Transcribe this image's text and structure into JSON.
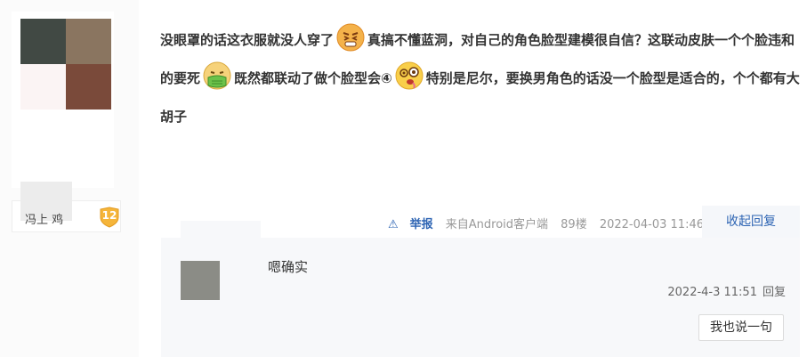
{
  "author": {
    "username": "冯上 鸡",
    "level": "12"
  },
  "post": {
    "segments": [
      "没眼罩的话这衣服就没人穿了",
      "真搞不懂蓝洞，对自己的角色脸型建模很自信？这联动皮肤一个个脸违和的要死",
      "既然都联动了做个脸型会④",
      "特别是尼尔，要换男角色的话没一个脸型是适合的，个个都有大胡子"
    ],
    "emoticons": [
      "angry-face",
      "sick-face",
      "dizzy-face"
    ]
  },
  "meta": {
    "report": "举报",
    "source": "来自Android客户端",
    "floor": "89楼",
    "time": "2022-04-03 11:46"
  },
  "collapse_reply": "收起回复",
  "reply": {
    "text": "嗯确实",
    "time": "2022-4-3 11:51",
    "reply_label": "回复"
  },
  "say_one": "我也说一句",
  "colors": {
    "accent": "#2d64b3",
    "badge": "#f5b53a"
  }
}
